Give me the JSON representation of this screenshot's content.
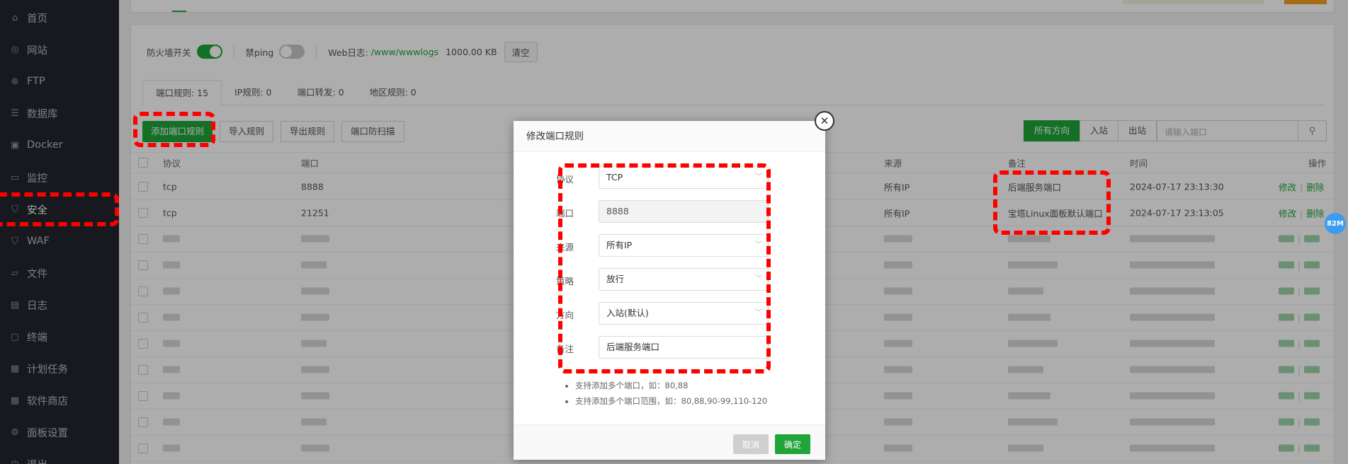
{
  "sidebar": {
    "items": [
      {
        "label": "首页",
        "icon": "home-icon"
      },
      {
        "label": "网站",
        "icon": "globe-icon"
      },
      {
        "label": "FTP",
        "icon": "ftp-icon"
      },
      {
        "label": "数据库",
        "icon": "database-icon"
      },
      {
        "label": "Docker",
        "icon": "docker-icon"
      },
      {
        "label": "监控",
        "icon": "monitor-icon"
      },
      {
        "label": "安全",
        "icon": "shield-icon"
      },
      {
        "label": "WAF",
        "icon": "waf-icon"
      },
      {
        "label": "文件",
        "icon": "folder-icon"
      },
      {
        "label": "日志",
        "icon": "log-icon"
      },
      {
        "label": "终端",
        "icon": "terminal-icon"
      },
      {
        "label": "计划任务",
        "icon": "calendar-icon"
      },
      {
        "label": "软件商店",
        "icon": "store-icon"
      },
      {
        "label": "面板设置",
        "icon": "gear-icon"
      },
      {
        "label": "退出",
        "icon": "logout-icon"
      }
    ],
    "active_index": 6
  },
  "toolbar": {
    "firewall_label": "防火墙开关",
    "firewall_on": true,
    "ping_label": "禁ping",
    "ping_on": false,
    "weblog_label": "Web日志:",
    "weblog_path": "/www/wwwlogs",
    "weblog_size": "1000.00 KB",
    "clear_label": "清空"
  },
  "tabs": [
    {
      "label": "端口规则: 15",
      "active": true
    },
    {
      "label": "IP规则: 0",
      "active": false
    },
    {
      "label": "端口转发: 0",
      "active": false
    },
    {
      "label": "地区规则: 0",
      "active": false
    }
  ],
  "actions": {
    "add_rule": "添加端口规则",
    "import_rule": "导入规则",
    "export_rule": "导出规则",
    "port_scan": "端口防扫描"
  },
  "direction_filter": {
    "options": [
      "所有方向",
      "入站",
      "出站"
    ],
    "active_index": 0
  },
  "port_search": {
    "placeholder": "请输入端口"
  },
  "table": {
    "columns": [
      "协议",
      "端口",
      "来源",
      "备注",
      "时间",
      "操作"
    ],
    "rows": [
      {
        "protocol": "tcp",
        "port": "8888",
        "source": "所有IP",
        "note": "后端服务端口",
        "time": "2024-07-17 23:13:30",
        "edit": "修改",
        "delete": "删除"
      },
      {
        "protocol": "tcp",
        "port": "21251",
        "source": "所有IP",
        "note": "宝塔Linux面板默认端口",
        "time": "2024-07-17 23:13:05",
        "edit": "修改",
        "delete": "删除"
      }
    ],
    "obscured_rows": 9
  },
  "speed_badge": "82M",
  "modal": {
    "title": "修改端口规则",
    "fields": [
      {
        "label": "协议",
        "value": "TCP",
        "type": "select"
      },
      {
        "label": "端口",
        "value": "8888",
        "type": "disabled"
      },
      {
        "label": "来源",
        "value": "所有IP",
        "type": "select"
      },
      {
        "label": "策略",
        "value": "放行",
        "type": "select"
      },
      {
        "label": "方向",
        "value": "入站(默认)",
        "type": "select"
      },
      {
        "label": "备注",
        "value": "后端服务端口",
        "type": "input"
      }
    ],
    "tips": [
      "支持添加多个端口，如：80,88",
      "支持添加多个端口范围，如：80,88,90-99,110-120"
    ],
    "cancel_label": "取消",
    "ok_label": "确定"
  },
  "colors": {
    "accent": "#20a53a",
    "sidebar_bg": "#23262d",
    "annotation": "#ff0000",
    "badge": "#3b9cf0"
  }
}
